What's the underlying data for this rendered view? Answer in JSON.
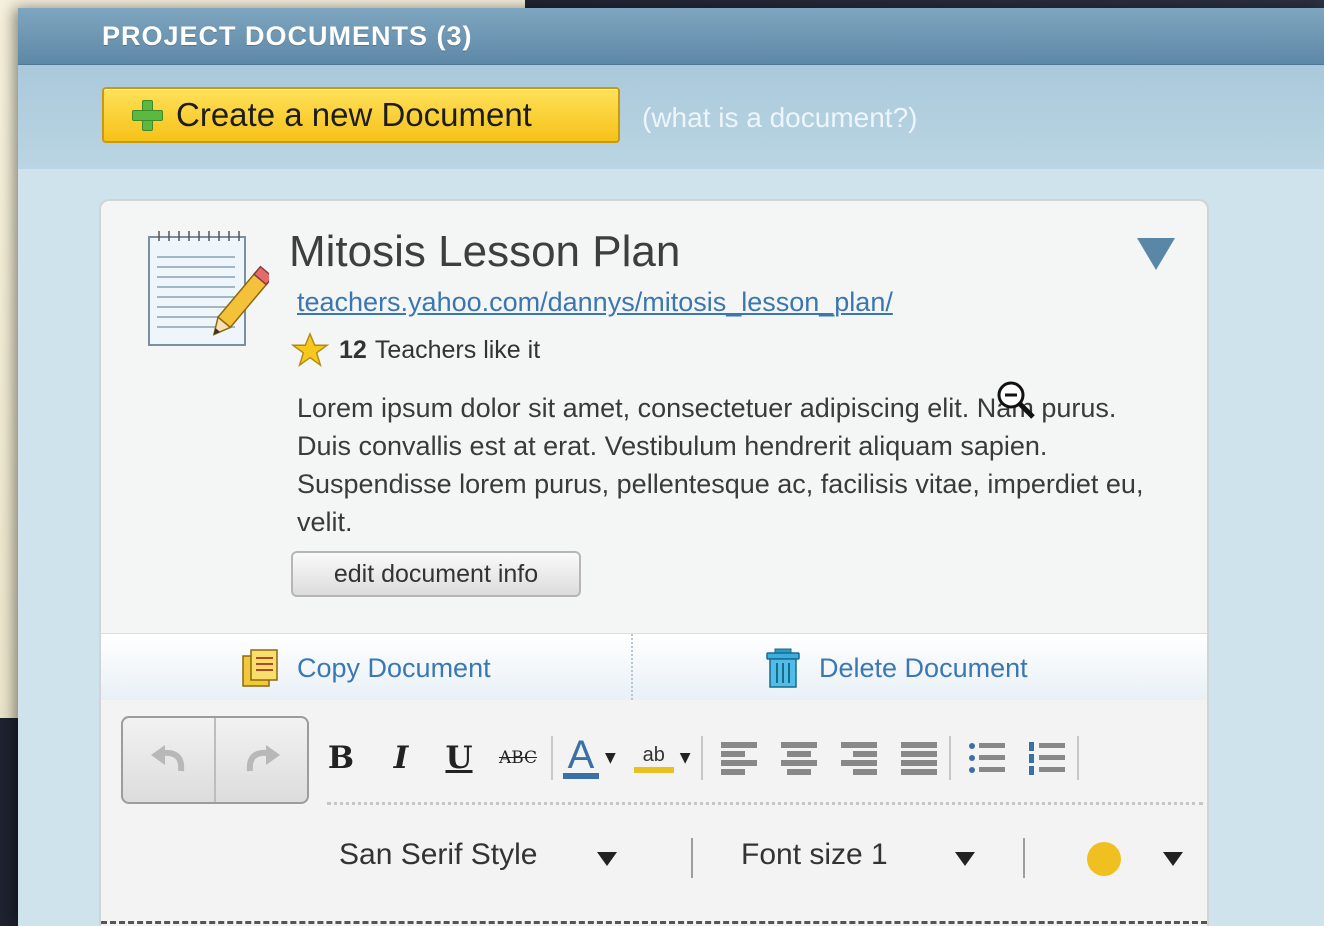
{
  "panel": {
    "title": "PROJECT DOCUMENTS (3)",
    "create_button_label": "Create a new Document",
    "help_link": "(what is a document?)"
  },
  "document": {
    "title": "Mitosis Lesson Plan",
    "url": "teachers.yahoo.com/dannys/mitosis_lesson_plan/",
    "likes_count": "12",
    "likes_text": "Teachers like it",
    "description": "Lorem ipsum dolor sit amet, consectetuer adipiscing elit. Nam purus. Duis convallis est at erat. Vestibulum hendrerit aliquam sapien. Suspendisse lorem purus, pellentesque ac, facilisis vitae, imperdiet eu, velit.",
    "edit_button_label": "edit document info",
    "copy_label": "Copy Document",
    "delete_label": "Delete Document"
  },
  "editor": {
    "bold": "B",
    "italic": "I",
    "underline": "U",
    "strike": "ABC",
    "font_color_glyph": "A",
    "highlight_glyph": "ab",
    "font_style": "San Serif Style",
    "font_size": "Font size 1",
    "accent_color": "#f0c020"
  },
  "colors": {
    "header_blue": "#5d88a7",
    "link_blue": "#3b76b0",
    "button_yellow": "#f6c218"
  }
}
